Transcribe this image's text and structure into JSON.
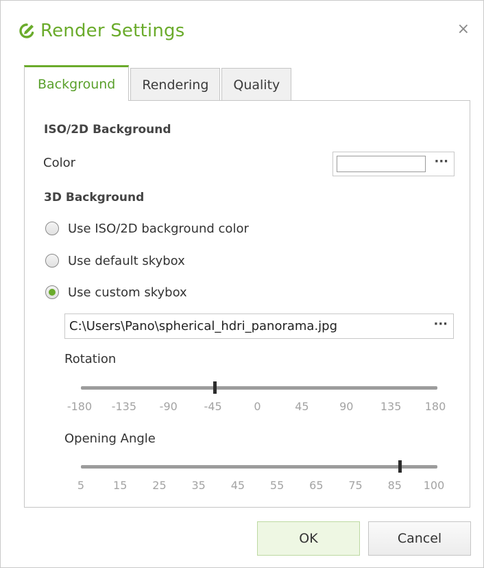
{
  "dialog": {
    "title": "Render Settings",
    "close_glyph": "×",
    "title_icon": "pencil-check-icon",
    "accent_color": "#6aab2b"
  },
  "tabs": [
    {
      "label": "Background",
      "active": true
    },
    {
      "label": "Rendering",
      "active": false
    },
    {
      "label": "Quality",
      "active": false
    }
  ],
  "iso_background": {
    "section_title": "ISO/2D Background",
    "color_label": "Color",
    "color_value": "#ffffff",
    "browse_glyph": "···"
  },
  "bg3d": {
    "section_title": "3D Background",
    "options": [
      {
        "label": "Use ISO/2D background color",
        "checked": false
      },
      {
        "label": "Use default skybox",
        "checked": false
      },
      {
        "label": "Use custom skybox",
        "checked": true
      }
    ],
    "skybox_path": "C:\\Users\\Pano\\spherical_hdri_panorama.jpg",
    "browse_glyph": "···"
  },
  "rotation": {
    "label": "Rotation",
    "ticks": [
      "-180",
      "-135",
      "-90",
      "-45",
      "0",
      "45",
      "90",
      "135",
      "180"
    ],
    "min": -180,
    "max": 180,
    "value": -45
  },
  "opening_angle": {
    "label": "Opening Angle",
    "ticks": [
      "5",
      "15",
      "25",
      "35",
      "45",
      "55",
      "65",
      "75",
      "85",
      "100"
    ],
    "min": 5,
    "max": 100,
    "value": 90
  },
  "buttons": {
    "ok": "OK",
    "cancel": "Cancel"
  }
}
